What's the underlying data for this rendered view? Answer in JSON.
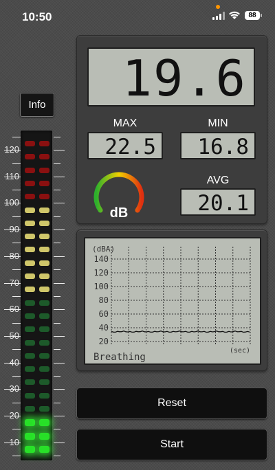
{
  "status_bar": {
    "time": "10:50",
    "battery": "88"
  },
  "info_button": {
    "label": "Info"
  },
  "meter": {
    "scale_labels": [
      "120",
      "110",
      "100",
      "90",
      "80",
      "70",
      "60",
      "50",
      "40",
      "30",
      "20",
      "10"
    ],
    "level_db": 19.6,
    "colors": {
      "green": "#28e028",
      "green_dim": "#1d5a2a",
      "yellow": "#cfc66a",
      "red": "#8a1010"
    }
  },
  "display": {
    "current_value": "19.6",
    "max_label": "MAX",
    "max_value": "22.5",
    "min_label": "MIN",
    "min_value": "16.8",
    "avg_label": "AVG",
    "avg_value": "20.1",
    "gauge_unit": "dB"
  },
  "graph": {
    "y_unit": "(dBA)",
    "y_ticks": [
      "140",
      "120",
      "100",
      "80",
      "60",
      "40",
      "20"
    ],
    "x_unit": "(sec)",
    "description": "Breathing"
  },
  "buttons": {
    "reset": "Reset",
    "start": "Start"
  }
}
